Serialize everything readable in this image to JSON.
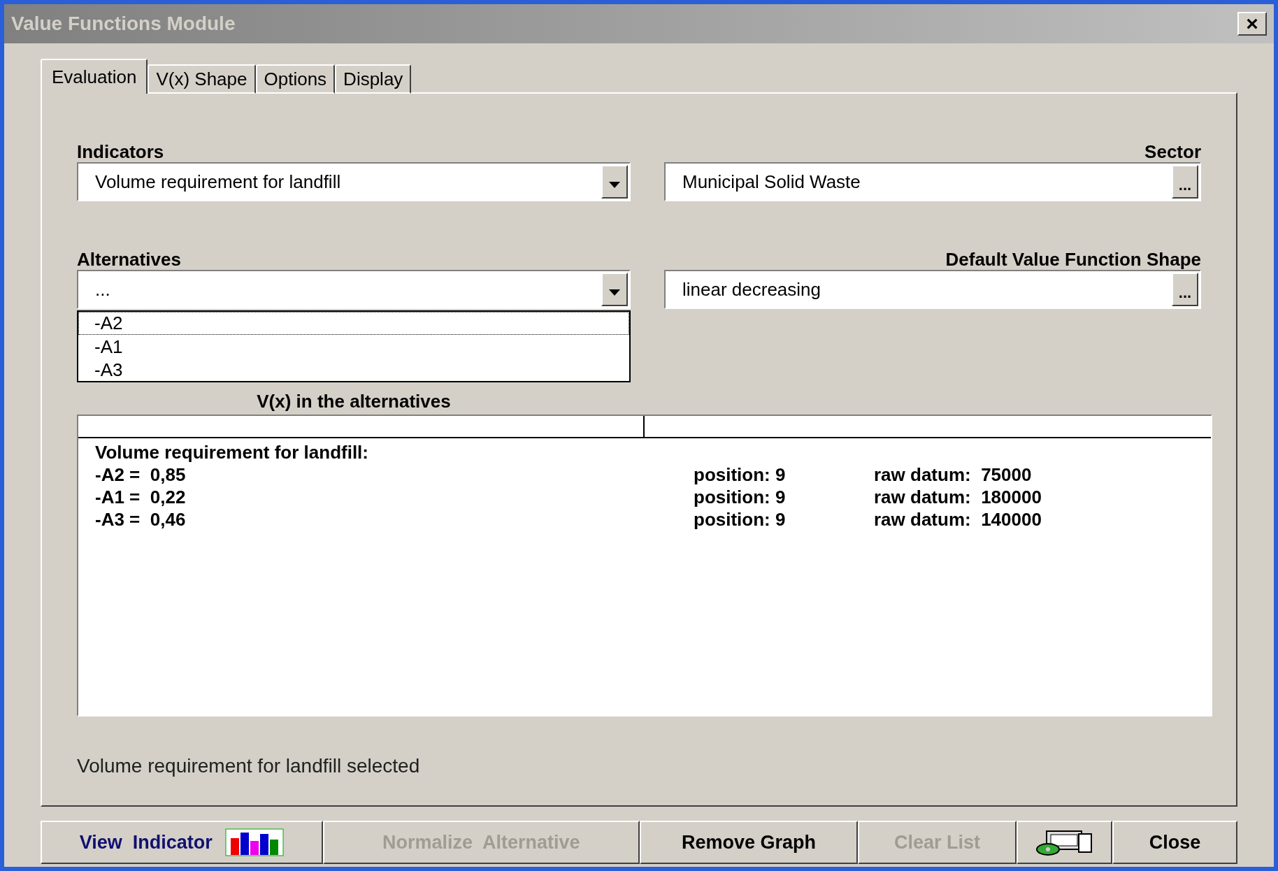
{
  "window": {
    "title": "Value Functions Module",
    "close": "×"
  },
  "tabs": [
    {
      "label": "Evaluation",
      "selected": true
    },
    {
      "label": "V(x) Shape",
      "selected": false
    },
    {
      "label": "Options",
      "selected": false
    },
    {
      "label": "Display",
      "selected": false
    }
  ],
  "indicators": {
    "label": "Indicators",
    "value": "Volume requirement for landfill"
  },
  "sector": {
    "label": "Sector",
    "value": "Municipal Solid Waste",
    "button": "..."
  },
  "alternatives": {
    "label": "Alternatives",
    "value": "...",
    "options": [
      {
        "label": "-A2",
        "selected": true
      },
      {
        "label": "-A1",
        "selected": false
      },
      {
        "label": "-A3",
        "selected": false
      }
    ]
  },
  "default_shape": {
    "label": "Default Value Function Shape",
    "value": "linear decreasing",
    "button": "..."
  },
  "results": {
    "title": "V(x) in the alternatives",
    "heading": "Volume requirement for landfill:",
    "rows": [
      {
        "alternative": "-A2 =  0,85",
        "position": "position: 9",
        "raw": "raw datum:  75000"
      },
      {
        "alternative": "-A1 =  0,22",
        "position": "position: 9",
        "raw": "raw datum:  180000"
      },
      {
        "alternative": "-A3 =  0,46",
        "position": "position: 9",
        "raw": "raw datum:  140000"
      }
    ]
  },
  "status": "Volume requirement for landfill selected",
  "buttons": [
    {
      "kind": "chart",
      "label": "View  Indicator",
      "disabled": false
    },
    {
      "kind": "text",
      "label": "Normalize  Alternative",
      "disabled": true
    },
    {
      "kind": "text",
      "label": "Remove Graph",
      "disabled": false
    },
    {
      "kind": "text",
      "label": "Clear List",
      "disabled": true
    },
    {
      "kind": "icon",
      "disabled": false
    },
    {
      "kind": "text",
      "label": "Close",
      "disabled": false
    }
  ]
}
